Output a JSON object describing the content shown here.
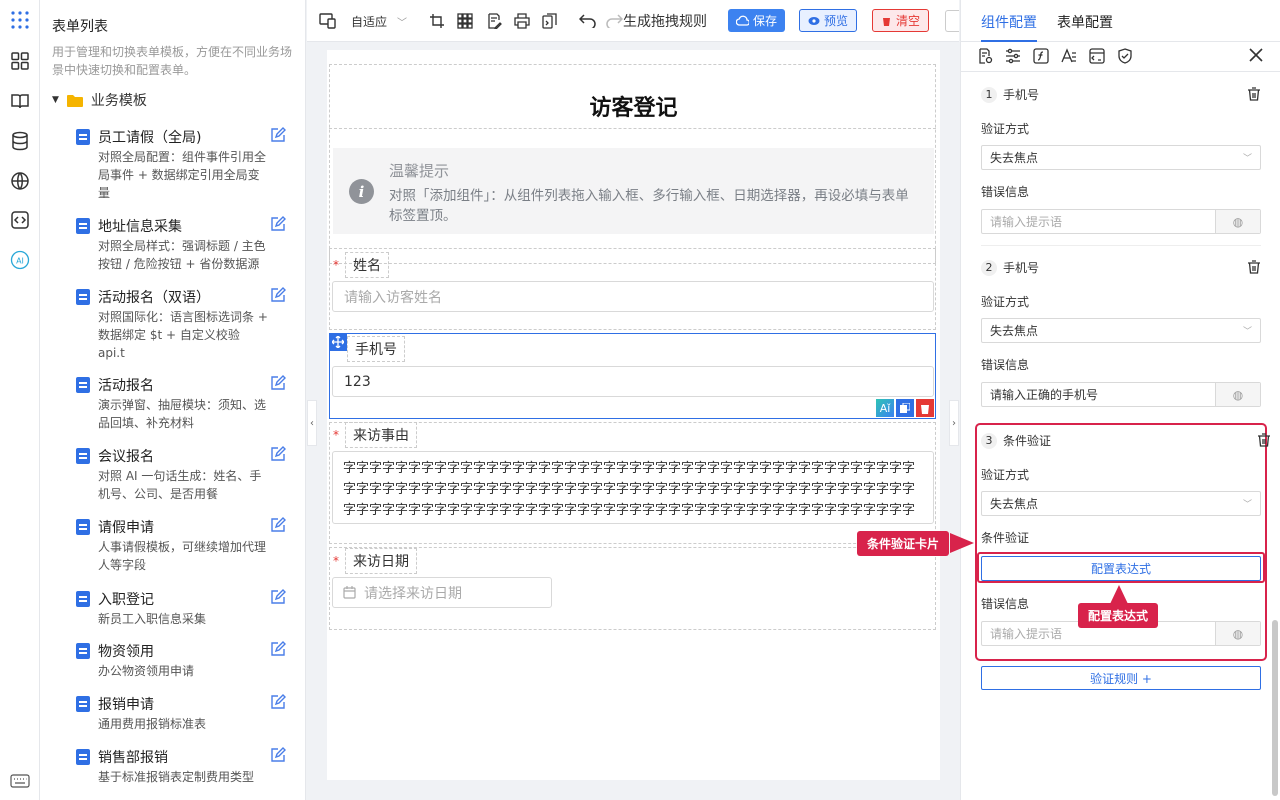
{
  "rail": {
    "items": [
      "grid-dots-icon",
      "apps-icon",
      "book-icon",
      "database-icon",
      "globe-icon",
      "code-icon",
      "ai-icon",
      "keyboard-icon"
    ]
  },
  "sidebar": {
    "title": "表单列表",
    "desc": "用于管理和切换表单模板，方便在不同业务场景中快速切换和配置表单。",
    "folder": "业务模板",
    "items": [
      {
        "name": "员工请假（全局)",
        "desc": "对照全局配置：组件事件引用全局事件 + 数据绑定引用全局变量"
      },
      {
        "name": "地址信息采集",
        "desc": "对照全局样式：强调标题 / 主色按钮 / 危险按钮 + 省份数据源"
      },
      {
        "name": "活动报名（双语）",
        "desc": "对照国际化：语言图标选词条 + 数据绑定 $t + 自定义校验 api.t"
      },
      {
        "name": "活动报名",
        "desc": "演示弹窗、抽屉模块：须知、选品回填、补充材料"
      },
      {
        "name": "会议报名",
        "desc": "对照 AI 一句话生成：姓名、手机号、公司、是否用餐"
      },
      {
        "name": "请假申请",
        "desc": "人事请假模板，可继续增加代理人等字段"
      },
      {
        "name": "入职登记",
        "desc": "新员工入职信息采集"
      },
      {
        "name": "物资领用",
        "desc": "办公物资领用申请"
      },
      {
        "name": "报销申请",
        "desc": "通用费用报销标准表"
      },
      {
        "name": "销售部报销",
        "desc": "基于标准报销表定制费用类型"
      }
    ]
  },
  "toolbar": {
    "adapt": "自适应",
    "generate": "生成拖拽规则",
    "save": "保存",
    "preview": "预览",
    "clear": "清空"
  },
  "form": {
    "title": "访客登记",
    "tip_title": "温馨提示",
    "tip_text": "对照「添加组件」：从组件列表拖入输入框、多行输入框、日期选择器，再设必填与表单标签置顶。",
    "name_label": "姓名",
    "name_placeholder": "请输入访客姓名",
    "phone_label": "手机号",
    "phone_value": "123",
    "reason_label": "来访事由",
    "reason_text": "字字字字字字字字字字字字字字字字字字字字字字字字字字字字字字字字字字字字字字字字字字字字字字字字字字字字字字字字字字字字字字字字字字字字字字字字字字字字字字字字字字字字字字字字字字字字字字字字字字字字字字字字字字字字字字字字字字字字字字字字字字字字字字字字字字字字字字字字字字字字",
    "date_label": "来访日期",
    "date_placeholder": "请选择来访日期",
    "required": "*"
  },
  "right": {
    "tab_component": "组件配置",
    "tab_form": "表单配置",
    "rules": [
      {
        "num": "1",
        "title": "手机号",
        "method_label": "验证方式",
        "method_value": "失去焦点",
        "error_label": "错误信息",
        "error_placeholder": "请输入提示语",
        "error_value": ""
      },
      {
        "num": "2",
        "title": "手机号",
        "method_label": "验证方式",
        "method_value": "失去焦点",
        "error_label": "错误信息",
        "error_placeholder": "",
        "error_value": "请输入正确的手机号"
      },
      {
        "num": "3",
        "title": "条件验证",
        "method_label": "验证方式",
        "method_value": "失去焦点",
        "cond_label": "条件验证",
        "cond_button": "配置表达式",
        "error_label": "错误信息",
        "error_placeholder": "请输入提示语"
      }
    ],
    "add_rule": "验证规则 +",
    "callout_card": "条件验证卡片",
    "callout_expr": "配置表达式"
  },
  "colors": {
    "accent": "#2f6fe4",
    "danger": "#d8234b",
    "callout": "#d8234b"
  }
}
